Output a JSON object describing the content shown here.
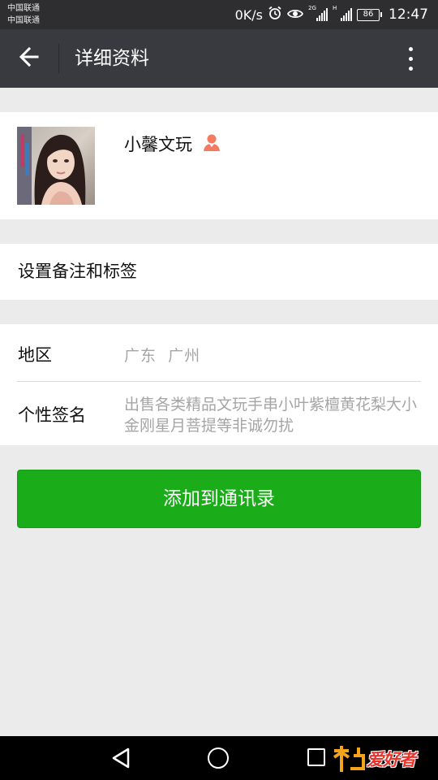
{
  "status_bar": {
    "carrier_1": "中国联通",
    "carrier_2": "中国联通",
    "net_speed": "0K/s",
    "network_tag_1": "2G",
    "network_tag_2": "H",
    "battery": "86",
    "time": "12:47"
  },
  "header": {
    "title": "详细资料",
    "back_icon": "arrow-left-icon",
    "more_icon": "more-vertical-icon"
  },
  "profile": {
    "nickname": "小馨文玩",
    "gender_icon": "female-person-icon",
    "gender_color": "#f37b61"
  },
  "remark": {
    "label": "设置备注和标签"
  },
  "info": {
    "region_label": "地区",
    "region_value": "广东  广州",
    "signature_label": "个性签名",
    "signature_value": "出售各类精品文玩手串小叶紫檀黄花梨大小金刚星月菩提等非诚勿扰"
  },
  "action": {
    "add_contact_label": "添加到通讯录",
    "accent_color": "#1aad19"
  },
  "watermark": {
    "text": "爱好者"
  }
}
